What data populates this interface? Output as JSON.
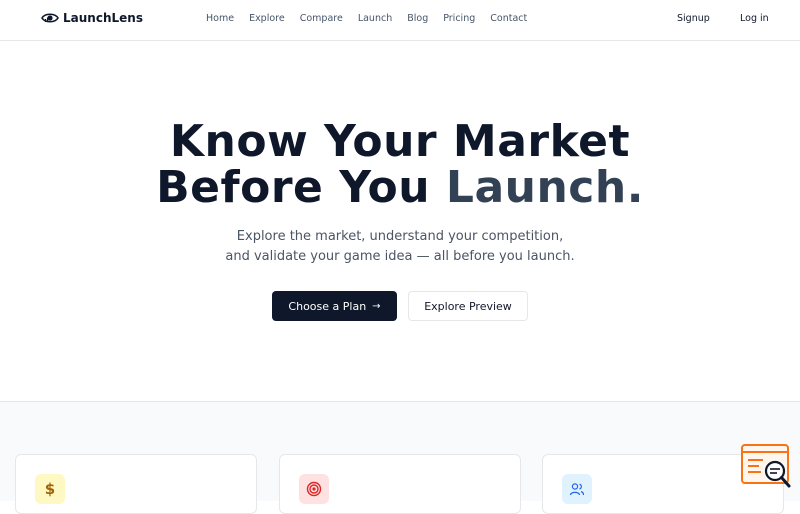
{
  "brand": {
    "name": "LaunchLens"
  },
  "nav": {
    "links": [
      "Home",
      "Explore",
      "Compare",
      "Launch",
      "Blog",
      "Pricing",
      "Contact"
    ],
    "signup": "Signup",
    "login": "Log in"
  },
  "hero": {
    "title_line1": "Know Your Market",
    "title_line2_a": "Before You ",
    "title_line2_b": "Launch.",
    "subtitle_line1": "Explore the market, understand your competition,",
    "subtitle_line2": "and validate your game idea — all before you launch.",
    "primary_cta": "Choose a Plan",
    "secondary_cta": "Explore Preview"
  },
  "features": {
    "icons": [
      "dollar-icon",
      "target-icon",
      "users-icon"
    ]
  },
  "colors": {
    "primary": "#0f172a",
    "accent": "#334155",
    "muted": "#4b5563"
  }
}
